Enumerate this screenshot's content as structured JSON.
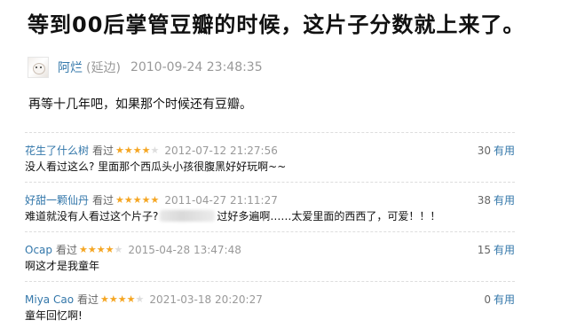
{
  "review": {
    "title": "等到00后掌管豆瓣的时候，这片子分数就上来了。",
    "author": {
      "name": "阿烂",
      "alias": "(延边)",
      "date": "2010-09-24 23:48:35",
      "avatar_icon": "avatar-image"
    },
    "body": "再等十几年吧，如果那个时候还有豆瓣。"
  },
  "comments": [
    {
      "user": "花生了什么树",
      "seen": "看过",
      "rating": 4,
      "date": "2012-07-12 21:27:56",
      "text": "没人看过这么? 里面那个西瓜头小孩很腹黑好好玩啊~~",
      "text_before": "",
      "text_after": "",
      "votes": "30",
      "useful": "有用"
    },
    {
      "user": "好甜一颗仙丹",
      "seen": "看过",
      "rating": 5,
      "date": "2011-04-27 21:11:27",
      "text": "",
      "text_before": "难道就没有人看过这个片子?",
      "text_after": "过好多遍啊……太爱里面的西西了，可爱！！！",
      "votes": "38",
      "useful": "有用"
    },
    {
      "user": "Ocap",
      "seen": "看过",
      "rating": 4,
      "date": "2015-04-28 13:47:48",
      "text": "啊这才是我童年",
      "text_before": "",
      "text_after": "",
      "votes": "15",
      "useful": "有用"
    },
    {
      "user": "Miya Cao",
      "seen": "看过",
      "rating": 4,
      "date": "2021-03-18 20:20:27",
      "text": "童年回忆啊!",
      "text_before": "",
      "text_after": "",
      "votes": "0",
      "useful": "有用"
    }
  ],
  "colors": {
    "link": "#3377aa",
    "star": "#f5a623",
    "meta": "#999999"
  }
}
